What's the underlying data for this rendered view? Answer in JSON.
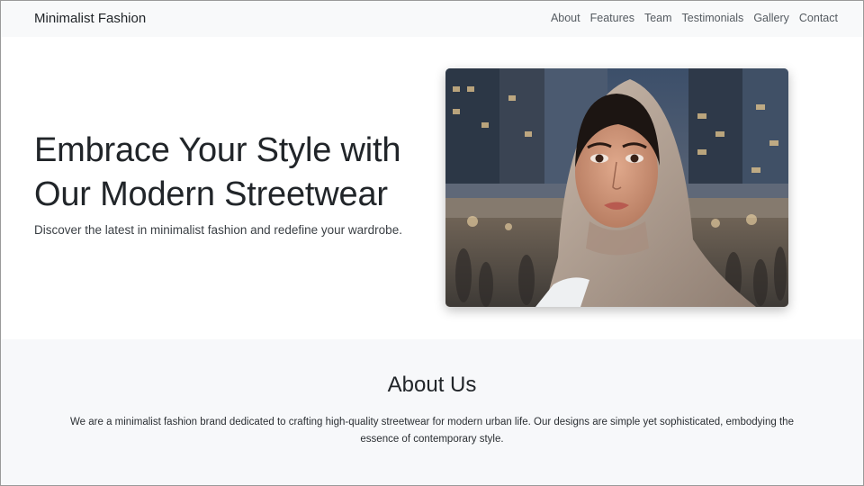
{
  "navbar": {
    "brand": "Minimalist Fashion",
    "links": [
      "About",
      "Features",
      "Team",
      "Testimonials",
      "Gallery",
      "Contact"
    ]
  },
  "hero": {
    "title": "Embrace Your Style with Our Modern Streetwear",
    "subtitle": "Discover the latest in minimalist fashion and redefine your wardrobe."
  },
  "about": {
    "title": "About Us",
    "text": "We are a minimalist fashion brand dedicated to crafting high-quality streetwear for modern urban life. Our designs are simple yet sophisticated, embodying the essence of contemporary style."
  }
}
